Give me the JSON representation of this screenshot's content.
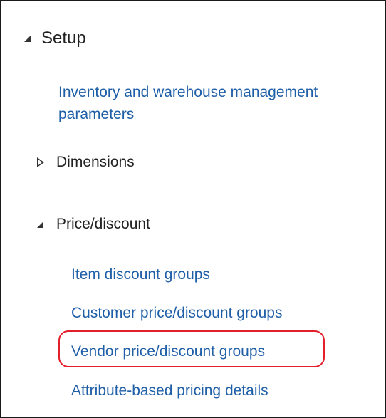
{
  "setup": {
    "label": "Setup",
    "link_line1": "Inventory and warehouse management",
    "link_line2": "parameters"
  },
  "dimensions": {
    "label": "Dimensions"
  },
  "price_discount": {
    "label": "Price/discount",
    "links": [
      "Item discount groups",
      "Customer price/discount groups",
      "Vendor price/discount groups",
      "Attribute-based pricing details"
    ]
  },
  "annotation": {
    "highlight_color": "#e21f2a",
    "highlighted_item": "Vendor price/discount groups"
  },
  "colors": {
    "link": "#1f5fa8",
    "text": "#222222",
    "border": "#1a1a1a"
  }
}
